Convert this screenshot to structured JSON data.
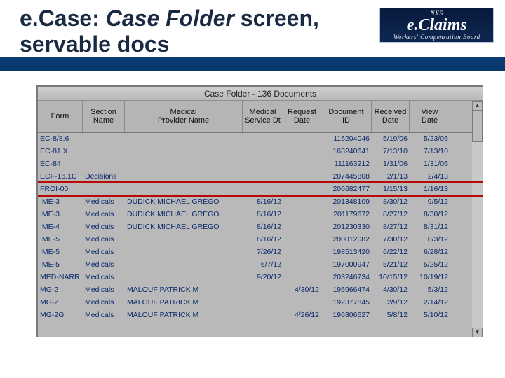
{
  "slide": {
    "title_prefix": "e.Case: ",
    "title_italic": "Case Folder",
    "title_suffix": " screen, servable docs"
  },
  "logo": {
    "top": "NYS",
    "main": "e.Claims",
    "sub": "Workers' Compensation Board"
  },
  "window": {
    "caption": "Case Folder - 136 Documents"
  },
  "columns": {
    "form": "Form",
    "section": "Section\nName",
    "provider": "Medical\nProvider Name",
    "servdt": "Medical\nService Dt",
    "reqdt": "Request\nDate",
    "docid": "Document\nID",
    "recvd": "Received\nDate",
    "viewdt": "View\nDate"
  },
  "rows": [
    {
      "form": "EC-8/8.6",
      "section": "",
      "provider": "",
      "servdt": "",
      "reqdt": "",
      "docid": "115204046",
      "recvd": "5/19/06",
      "viewdt": "5/23/06"
    },
    {
      "form": "EC-81.X",
      "section": "",
      "provider": "",
      "servdt": "",
      "reqdt": "",
      "docid": "168240641",
      "recvd": "7/13/10",
      "viewdt": "7/13/10"
    },
    {
      "form": "EC-84",
      "section": "",
      "provider": "",
      "servdt": "",
      "reqdt": "",
      "docid": "111163212",
      "recvd": "1/31/06",
      "viewdt": "1/31/06"
    },
    {
      "form": "ECF-16.1C",
      "section": "Decisions",
      "provider": "",
      "servdt": "",
      "reqdt": "",
      "docid": "207445808",
      "recvd": "2/1/13",
      "viewdt": "2/4/13"
    },
    {
      "form": "FROI-00",
      "section": "",
      "provider": "",
      "servdt": "",
      "reqdt": "",
      "docid": "206682477",
      "recvd": "1/15/13",
      "viewdt": "1/16/13"
    },
    {
      "form": "IME-3",
      "section": "Medicals",
      "provider": "DUDICK MICHAEL GREGO",
      "servdt": "8/16/12",
      "reqdt": "",
      "docid": "201348109",
      "recvd": "8/30/12",
      "viewdt": "9/5/12"
    },
    {
      "form": "IME-3",
      "section": "Medicals",
      "provider": "DUDICK MICHAEL GREGO",
      "servdt": "8/16/12",
      "reqdt": "",
      "docid": "201179672",
      "recvd": "8/27/12",
      "viewdt": "8/30/12"
    },
    {
      "form": "IME-4",
      "section": "Medicals",
      "provider": "DUDICK MICHAEL GREGO",
      "servdt": "8/16/12",
      "reqdt": "",
      "docid": "201230330",
      "recvd": "8/27/12",
      "viewdt": "8/31/12"
    },
    {
      "form": "IME-5",
      "section": "Medicals",
      "provider": "",
      "servdt": "8/16/12",
      "reqdt": "",
      "docid": "200012082",
      "recvd": "7/30/12",
      "viewdt": "8/3/12"
    },
    {
      "form": "IME-5",
      "section": "Medicals",
      "provider": "",
      "servdt": "7/26/12",
      "reqdt": "",
      "docid": "198513420",
      "recvd": "6/22/12",
      "viewdt": "6/28/12"
    },
    {
      "form": "IME-5",
      "section": "Medicals",
      "provider": "",
      "servdt": "6/7/12",
      "reqdt": "",
      "docid": "197000947",
      "recvd": "5/21/12",
      "viewdt": "5/25/12"
    },
    {
      "form": "MED-NARR",
      "section": "Medicals",
      "provider": "",
      "servdt": "9/20/12",
      "reqdt": "",
      "docid": "203246734",
      "recvd": "10/15/12",
      "viewdt": "10/19/12"
    },
    {
      "form": "MG-2",
      "section": "Medicals",
      "provider": "MALOUF PATRICK M",
      "servdt": "",
      "reqdt": "4/30/12",
      "docid": "195966474",
      "recvd": "4/30/12",
      "viewdt": "5/3/12"
    },
    {
      "form": "MG-2",
      "section": "Medicals",
      "provider": "MALOUF PATRICK M",
      "servdt": "",
      "reqdt": "",
      "docid": "192377845",
      "recvd": "2/9/12",
      "viewdt": "2/14/12"
    },
    {
      "form": "MG-2G",
      "section": "Medicals",
      "provider": "MALOUF PATRICK M",
      "servdt": "",
      "reqdt": "4/26/12",
      "docid": "196306627",
      "recvd": "5/8/12",
      "viewdt": "5/10/12"
    }
  ],
  "highlight_index": 4
}
